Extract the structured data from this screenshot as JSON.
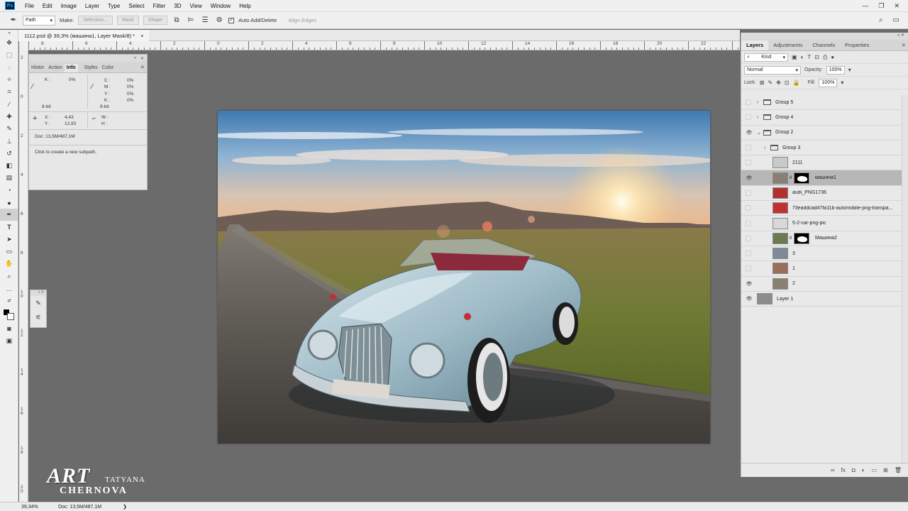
{
  "app": {
    "logo": "Ps",
    "window_controls": [
      "—",
      "❐",
      "✕"
    ]
  },
  "menu": [
    "File",
    "Edit",
    "Image",
    "Layer",
    "Type",
    "Select",
    "Filter",
    "3D",
    "View",
    "Window",
    "Help"
  ],
  "options": {
    "mode_value": "Path",
    "make_label": "Make:",
    "selection_btn": "Selection...",
    "mask_btn": "Mask",
    "shape_btn": "Shape",
    "auto_add_delete": "Auto Add/Delete",
    "align_edges": "Align Edges"
  },
  "document": {
    "tab_title": "1112.psd @ 39,3% (машина1, Layer Mask/8) *",
    "close": "×",
    "ruler_h": [
      "8",
      "6",
      "4",
      "2",
      "0",
      "2",
      "4",
      "6",
      "8",
      "10",
      "12",
      "14",
      "16",
      "18",
      "20",
      "22",
      "23"
    ],
    "ruler_v": [
      "2",
      "0",
      "2",
      "4",
      "6",
      "8",
      "1\n0",
      "1\n2",
      "1\n4",
      "1\n6",
      "1\n8",
      "2\n0"
    ]
  },
  "info_panel": {
    "tabs": [
      "Histor",
      "Action",
      "Info",
      "Styles",
      "Color"
    ],
    "active_tab": "Info",
    "k_label": "K :",
    "k_value": "0%",
    "bit1": "8-bit",
    "cmyk_labels": [
      "C :",
      "M :",
      "Y :",
      "K :"
    ],
    "cmyk_values": [
      "0%",
      "0%",
      "0%",
      "0%"
    ],
    "bit2": "8-bit",
    "x_label": "X :",
    "y_label": "Y :",
    "x_value": "4,43",
    "y_value": "12,93",
    "w_label": "W :",
    "h_label": "H :",
    "doc_size": "Doc: 13,5M/487,1M",
    "hint": "Click to create a new subpath."
  },
  "layers_panel": {
    "tabs": [
      "Layers",
      "Adjustments",
      "Channels",
      "Properties"
    ],
    "active_tab": "Layers",
    "kind_label": "Kind",
    "blend_mode": "Normal",
    "opacity_label": "Opacity:",
    "opacity_value": "100%",
    "lock_label": "Lock:",
    "fill_label": "Fill:",
    "fill_value": "100%",
    "layers": [
      {
        "name": "Group 5",
        "type": "group",
        "visible": false,
        "expanded": false,
        "indent": 0
      },
      {
        "name": "Group 4",
        "type": "group",
        "visible": false,
        "expanded": false,
        "indent": 0
      },
      {
        "name": "Group 2",
        "type": "group",
        "visible": true,
        "expanded": true,
        "indent": 0
      },
      {
        "name": "Group 3",
        "type": "group",
        "visible": false,
        "expanded": false,
        "indent": 1
      },
      {
        "name": "2111",
        "type": "layer",
        "visible": false,
        "thumb": "#c9c9c9",
        "indent": 1
      },
      {
        "name": "машина1",
        "type": "layer",
        "visible": true,
        "selected": true,
        "mask": true,
        "thumb": "#8a7f74",
        "indent": 1
      },
      {
        "name": "audi_PNG1736",
        "type": "layer",
        "visible": false,
        "thumb": "#b03030",
        "indent": 1
      },
      {
        "name": "73eaddcad47fa11b-automobile-png-transpa...",
        "type": "layer",
        "visible": false,
        "thumb": "#c23030",
        "indent": 1
      },
      {
        "name": "5-2-car-png-pic",
        "type": "layer",
        "visible": false,
        "thumb": "#d8d8d8",
        "indent": 1
      },
      {
        "name": "Машина2",
        "type": "layer",
        "visible": false,
        "mask": true,
        "thumb": "#6b7a50",
        "indent": 1
      },
      {
        "name": "3",
        "type": "layer",
        "visible": false,
        "thumb": "#7c8b96",
        "indent": 1
      },
      {
        "name": "1",
        "type": "layer",
        "visible": false,
        "thumb": "#9a6e5a",
        "indent": 1
      },
      {
        "name": "2",
        "type": "layer",
        "visible": true,
        "thumb": "#8a8070",
        "indent": 1
      },
      {
        "name": "Layer 1",
        "type": "layer",
        "visible": true,
        "thumb": "#8c8c8c",
        "indent": 0,
        "plain": true
      }
    ],
    "bottom_icons": [
      "∞",
      "fx",
      "◘",
      "◐",
      "▭",
      "⊞",
      "🗑"
    ]
  },
  "status": {
    "zoom": "39,34%",
    "doc": "Doc: 13,5M/487,1M",
    "arrow": "❯"
  },
  "watermark": {
    "art": "ART",
    "first": "TATYANA",
    "last": "CHERNOVA"
  }
}
